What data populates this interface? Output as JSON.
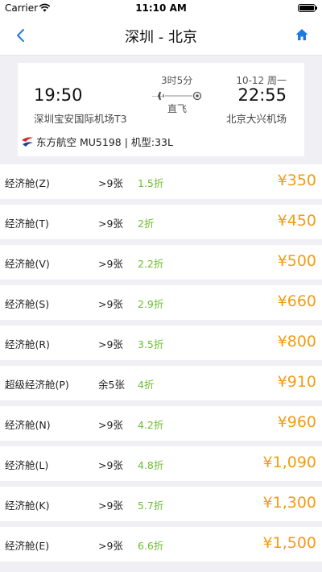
{
  "status_bar": {
    "carrier": "Carrier",
    "time": "11:10 AM"
  },
  "nav": {
    "title": "深圳 - 北京"
  },
  "flight": {
    "departure_time": "19:50",
    "arrival_time": "22:55",
    "duration": "3时5分",
    "stop_type": "直飞",
    "date": "10-12 周一",
    "departure_airport": "深圳宝安国际机场T3",
    "arrival_airport": "北京大兴机场",
    "airline_info": "东方航空 MU5198 | 机型:33L"
  },
  "colors": {
    "price": "#f39c12",
    "discount": "#6cbd2e",
    "accent": "#1f7ae0",
    "airline_red": "#d9262c",
    "airline_blue": "#1a3e8c"
  },
  "fares": [
    {
      "cabin": "经济舱(Z)",
      "seats": ">9张",
      "discount": "1.5折",
      "price": "¥350"
    },
    {
      "cabin": "经济舱(T)",
      "seats": ">9张",
      "discount": "2折",
      "price": "¥450"
    },
    {
      "cabin": "经济舱(V)",
      "seats": ">9张",
      "discount": "2.2折",
      "price": "¥500"
    },
    {
      "cabin": "经济舱(S)",
      "seats": ">9张",
      "discount": "2.9折",
      "price": "¥660"
    },
    {
      "cabin": "经济舱(R)",
      "seats": ">9张",
      "discount": "3.5折",
      "price": "¥800"
    },
    {
      "cabin": "超级经济舱(P)",
      "seats": "余5张",
      "discount": "4折",
      "price": "¥910"
    },
    {
      "cabin": "经济舱(N)",
      "seats": ">9张",
      "discount": "4.2折",
      "price": "¥960"
    },
    {
      "cabin": "经济舱(L)",
      "seats": ">9张",
      "discount": "4.8折",
      "price": "¥1,090"
    },
    {
      "cabin": "经济舱(K)",
      "seats": ">9张",
      "discount": "5.7折",
      "price": "¥1,300"
    },
    {
      "cabin": "经济舱(E)",
      "seats": ">9张",
      "discount": "6.6折",
      "price": "¥1,500"
    }
  ]
}
